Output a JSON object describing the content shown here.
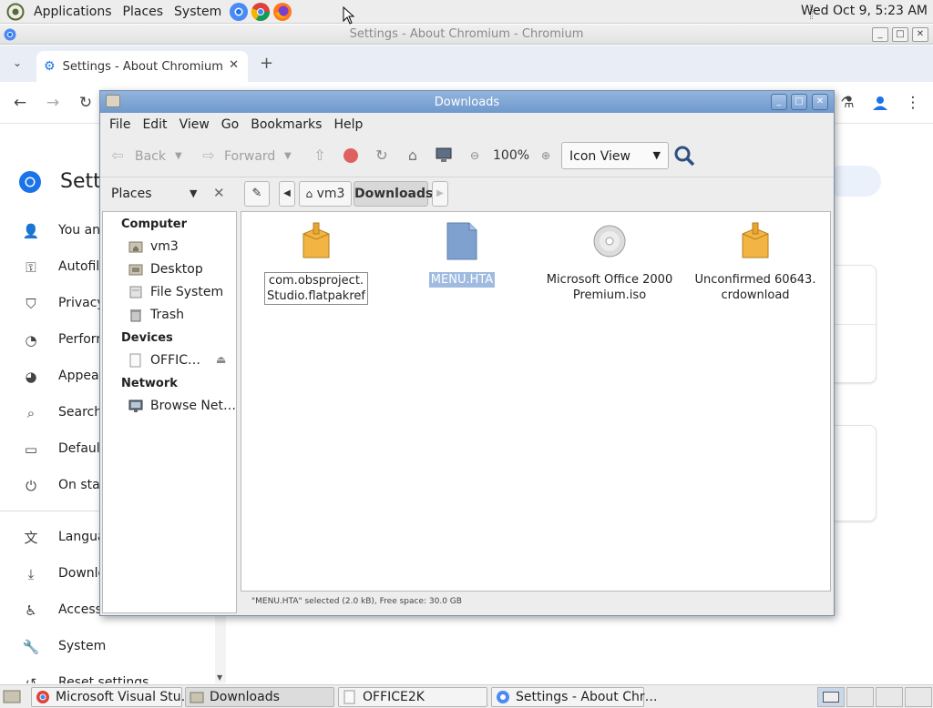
{
  "panel": {
    "menus": [
      "Applications",
      "Places",
      "System"
    ],
    "clock": "Wed Oct  9,  5:23 AM"
  },
  "chromium": {
    "window_title": "Settings - About Chromium - Chromium",
    "tab_title": "Settings - About Chromium",
    "page_title": "Sett",
    "nav_items": [
      {
        "label": "You and",
        "icon": "person-icon"
      },
      {
        "label": "Autofill",
        "icon": "key-icon"
      },
      {
        "label": "Privacy",
        "icon": "shield-icon"
      },
      {
        "label": "Perforn",
        "icon": "speedometer-icon"
      },
      {
        "label": "Appear",
        "icon": "palette-icon"
      },
      {
        "label": "Search",
        "icon": "search-icon"
      },
      {
        "label": "Default",
        "icon": "browser-icon"
      },
      {
        "label": "On star",
        "icon": "power-icon"
      },
      {
        "label": "Langua",
        "icon": "translate-icon"
      },
      {
        "label": "Downlo",
        "icon": "download-icon"
      },
      {
        "label": "Access",
        "icon": "accessibility-icon"
      },
      {
        "label": "System",
        "icon": "wrench-icon"
      },
      {
        "label": "Reset settings",
        "icon": "reset-icon"
      }
    ]
  },
  "file_manager": {
    "title": "Downloads",
    "menu": [
      "File",
      "Edit",
      "View",
      "Go",
      "Bookmarks",
      "Help"
    ],
    "toolbar": {
      "back": "Back",
      "forward": "Forward",
      "zoom": "100%",
      "view_mode": "Icon View"
    },
    "sidebar_selector": "Places",
    "breadcrumbs": [
      "vm3",
      "Downloads"
    ],
    "places": {
      "sections": [
        {
          "heading": "Computer",
          "items": [
            {
              "label": "vm3",
              "icon": "home-folder-icon"
            },
            {
              "label": "Desktop",
              "icon": "desktop-folder-icon"
            },
            {
              "label": "File System",
              "icon": "filesystem-icon"
            },
            {
              "label": "Trash",
              "icon": "trash-icon"
            }
          ]
        },
        {
          "heading": "Devices",
          "items": [
            {
              "label": "OFFIC…",
              "icon": "optical-drive-icon"
            }
          ]
        },
        {
          "heading": "Network",
          "items": [
            {
              "label": "Browse Net…",
              "icon": "network-icon"
            }
          ]
        }
      ]
    },
    "files": [
      {
        "line1": "com.obsproject.",
        "line2": "Studio.flatpakref",
        "icon": "package-icon"
      },
      {
        "line1": "MENU.HTA",
        "line2": "",
        "icon": "document-icon"
      },
      {
        "line1": "Microsoft Office 2000",
        "line2": "Premium.iso",
        "icon": "disc-image-icon"
      },
      {
        "line1": "Unconfirmed 60643.",
        "line2": "crdownload",
        "icon": "package-icon"
      }
    ],
    "status": "\"MENU.HTA\" selected (2.0 kB), Free space: 30.0 GB"
  },
  "taskbar": {
    "tasks": [
      {
        "label": "Microsoft Visual Stu…"
      },
      {
        "label": "Downloads"
      },
      {
        "label": "OFFICE2K"
      },
      {
        "label": "Settings - About Chr…"
      }
    ]
  },
  "colors": {
    "fm_title_bar": "#6f98cc",
    "selection": "#9fbbe0",
    "chromium_blue": "#1a73e8",
    "folder_orange": "#e8a52f"
  }
}
